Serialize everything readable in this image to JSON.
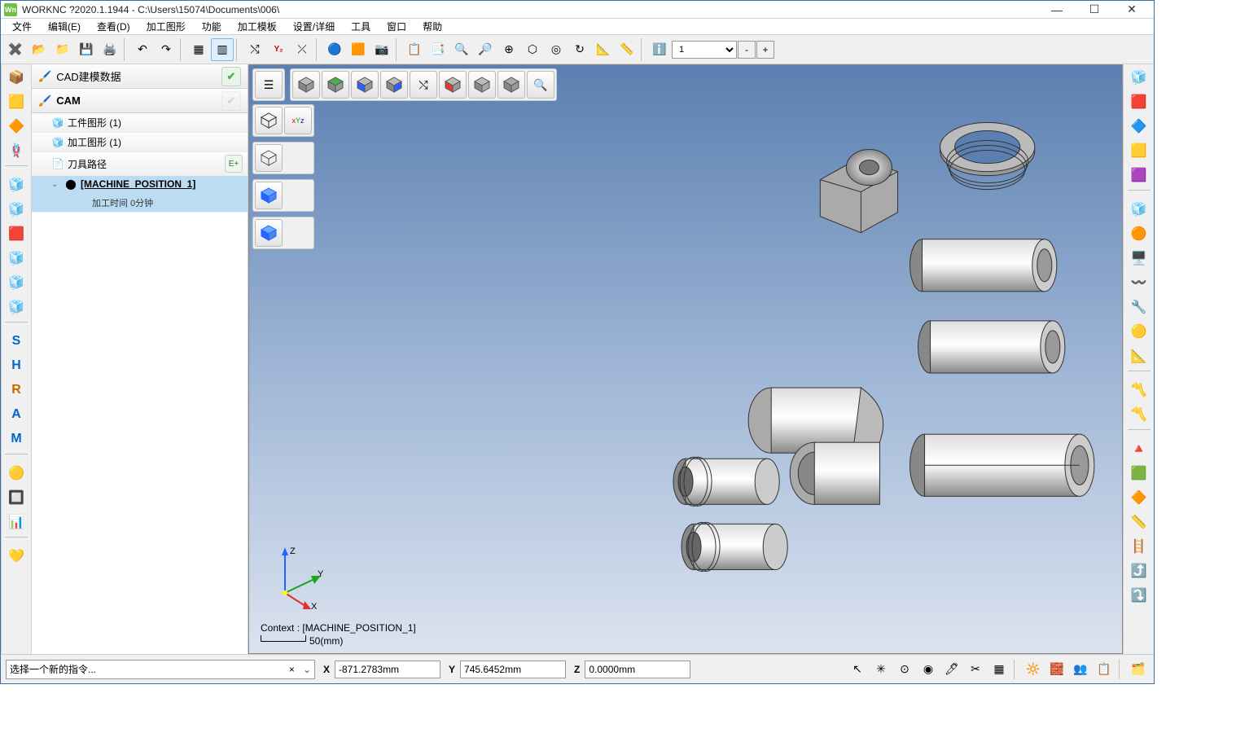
{
  "title": "WORKNC ?2020.1.1944 - C:\\Users\\15074\\Documents\\006\\",
  "app_icon_text": "Wn",
  "win_btns": {
    "min": "—",
    "max": "☐",
    "close": "✕"
  },
  "menu": [
    "文件",
    "编辑(E)",
    "查看(D)",
    "加工图形",
    "功能",
    "加工模板",
    "设置/详细",
    "工具",
    "窗口",
    "帮助"
  ],
  "level_value": "1",
  "level_minus": "-",
  "level_plus": "+",
  "tree": {
    "cad_header": "CAD建模数据",
    "cam_header": "CAM",
    "items": [
      {
        "label": "工件图形 (1)"
      },
      {
        "label": "加工图形 (1)"
      },
      {
        "label": "刀具路径"
      }
    ],
    "mpos": {
      "label": "[MACHINE_POSITION_1]",
      "sub": "加工时间 0分钟"
    }
  },
  "viewport": {
    "context": "Context : [MACHINE_POSITION_1]",
    "scale": "50(mm)",
    "axes": {
      "x": "X",
      "y": "Y",
      "z": "Z"
    }
  },
  "status": {
    "prompt": "选择一个新的指令...",
    "x_label": "X",
    "x_val": "-871.2783mm",
    "y_label": "Y",
    "y_val": "745.6452mm",
    "z_label": "Z",
    "z_val": "0.0000mm"
  },
  "axis_label": "Y₂"
}
